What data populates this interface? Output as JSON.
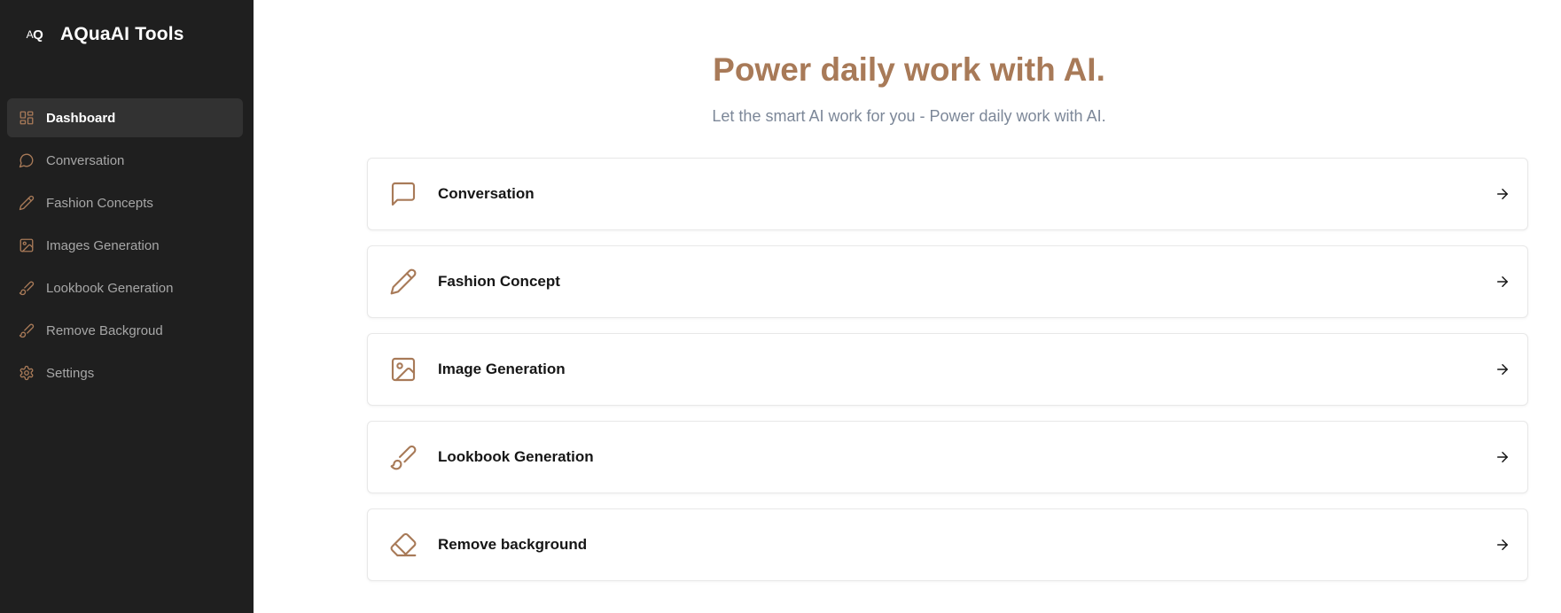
{
  "brand": {
    "logo_a": "A",
    "logo_q": "Q",
    "title": "AQuaAI Tools"
  },
  "colors": {
    "sidebar_bg": "#1f1f1f",
    "accent": "#a87a58",
    "subtitle": "#7c8798"
  },
  "sidebar": {
    "items": [
      {
        "label": "Dashboard",
        "icon": "dashboard-grid-icon",
        "active": true
      },
      {
        "label": "Conversation",
        "icon": "chat-bubble-icon",
        "active": false
      },
      {
        "label": "Fashion Concepts",
        "icon": "pencil-icon",
        "active": false
      },
      {
        "label": "Images Generation",
        "icon": "image-icon",
        "active": false
      },
      {
        "label": "Lookbook Generation",
        "icon": "brush-icon",
        "active": false
      },
      {
        "label": "Remove Backgroud",
        "icon": "brush-icon",
        "active": false
      },
      {
        "label": "Settings",
        "icon": "gear-icon",
        "active": false
      }
    ]
  },
  "main": {
    "title": "Power daily work with AI.",
    "subtitle": "Let the smart AI work for you - Power daily work with AI.",
    "cards": [
      {
        "label": "Conversation",
        "icon": "chat-bubble-icon"
      },
      {
        "label": "Fashion Concept",
        "icon": "pencil-icon"
      },
      {
        "label": "Image Generation",
        "icon": "image-icon"
      },
      {
        "label": "Lookbook Generation",
        "icon": "brush-icon"
      },
      {
        "label": "Remove background",
        "icon": "eraser-icon"
      }
    ]
  }
}
